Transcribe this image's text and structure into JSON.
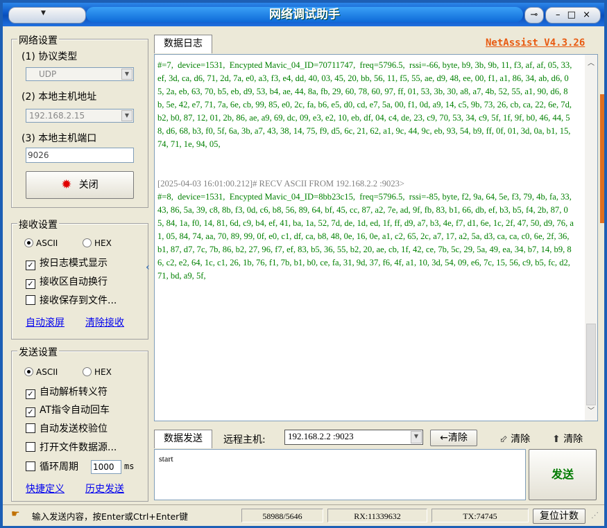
{
  "window": {
    "title": "网络调试助手",
    "pin_icon": "pin-icon",
    "minimize": "–",
    "maximize": "□",
    "close": "×"
  },
  "network": {
    "group_title": "网络设置",
    "protocol_label": "(1) 协议类型",
    "protocol_value": "UDP",
    "host_label": "(2) 本地主机地址",
    "host_value": "192.168.2.15",
    "port_label": "(3) 本地主机端口",
    "port_value": "9026",
    "close_button": "关闭"
  },
  "recv": {
    "group_title": "接收设置",
    "ascii": "ASCII",
    "hex": "HEX",
    "opt_log_mode": "按日志模式显示",
    "opt_auto_wrap": "接收区自动换行",
    "opt_save_file": "接收保存到文件...",
    "link_autoscroll": "自动滚屏",
    "link_clear": "清除接收"
  },
  "send_settings": {
    "group_title": "发送设置",
    "ascii": "ASCII",
    "hex": "HEX",
    "opt_escape": "自动解析转义符",
    "opt_at": "AT指令自动回车",
    "opt_checksum": "自动发送校验位",
    "opt_file_src": "打开文件数据源...",
    "opt_loop": "循环周期",
    "loop_value": "1000",
    "loop_unit": "ms",
    "link_shortcut": "快捷定义",
    "link_history": "历史发送"
  },
  "log": {
    "tab": "数据日志",
    "version": "NetAssist V4.3.26",
    "block1": "#=7,  device=1531,  Encypted Mavic_04_ID=70711747,  freq=5796.5,  rssi=-66, byte, b9, 3b, 9b, 11, f3, af, af, 05, 33, ef, 3d, ca, d6, 71, 2d, 7a, e0, a3, f3, e4, dd, 40, 03, 45, 20, bb, 56, 11, f5, 55, ae, d9, 48, ee, 00, f1, a1, 86, 34, ab, d6, 05, 2a, eb, 63, 70, b5, eb, d9, 53, b4, ae, 44, 8a, fb, 29, 60, 78, 60, 97, ff, 01, 53, 3b, 30, a8, a7, 4b, 52, 55, a1, 90, d6, 8b, 5e, 42, e7, 71, 7a, 6e, cb, 99, 85, e0, 2c, fa, b6, e5, d0, cd, e7, 5a, 00, f1, 0d, a9, 14, c5, 9b, 73, 26, cb, ca, 22, 6e, 7d, b2, b0, 87, 12, 01, 2b, 86, ae, a9, 69, dc, 09, e3, e2, 10, eb, df, 04, c4, de, 23, c9, 70, 53, 34, c9, 5f, 1f, 9f, b0, 46, 44, 58, d6, 68, b3, f0, 5f, 6a, 3b, a7, 43, 38, 14, 75, f9, d5, 6c, 21, 62, a1, 9c, 44, 9c, eb, 93, 54, b9, ff, 0f, 01, 3d, 0a, b1, 15, 74, 71, 1e, 94, 05,",
    "header2": "[2025-04-03 16:01:00.212]# RECV ASCII FROM 192.168.2.2 :9023>",
    "block2": "#=8,  device=1531,  Encypted Mavic_04_ID=8bb23c15,  freq=5796.5,  rssi=-85, byte, f2, 9a, 64, 5e, f3, 79, 4b, fa, 33, 43, 86, 5a, 39, c8, 8b, f3, 0d, c6, b8, 56, 89, 64, bf, 45, cc, 87, a2, 7e, ad, 9f, fb, 83, b1, 66, db, ef, b3, b5, f4, 2b, 87, 05, 84, 1a, f0, 14, 81, 6d, c9, b4, ef, 41, ba, 1a, 52, 7d, de, 1d, ed, 1f, ff, d9, a7, b3, 4e, f7, d1, 6e, 1c, 2f, 47, 50, d9, 76, a1, 05, 84, 74, aa, 70, 89, 99, 0f, e0, c1, df, ca, b8, 48, 0e, 16, 0e, a1, c2, 65, 2c, a7, 17, a2, 5a, d3, ca, ca, c0, 6e, 2f, 36, b1, 87, d7, 7c, 7b, 86, b2, 27, 96, f7, ef, 83, b5, 36, 55, b2, 20, ae, cb, 1f, 42, ce, 7b, 5c, 29, 5a, 49, ea, 34, b7, 14, b9, 86, c2, e2, 64, 1c, c1, 26, 1b, 76, f1, 7b, b1, b0, ce, fa, 31, 9d, 37, f6, 4f, a1, 10, 3d, 54, 09, e6, 7c, 15, 56, c9, b5, fc, d2, 71, bd, a9, 5f,"
  },
  "send": {
    "tab": "数据发送",
    "remote_label": "远程主机:",
    "remote_value": "192.168.2.2 :9023",
    "clear1": "清除",
    "clear2": "清除",
    "clear3": "清除",
    "text": "start",
    "send_button": "发送"
  },
  "status": {
    "hint": "输入发送内容，按Enter或Ctrl+Enter键",
    "counts": "58988/5646",
    "rx": "RX:11339632",
    "tx": "TX:74745",
    "reset": "复位计数"
  }
}
